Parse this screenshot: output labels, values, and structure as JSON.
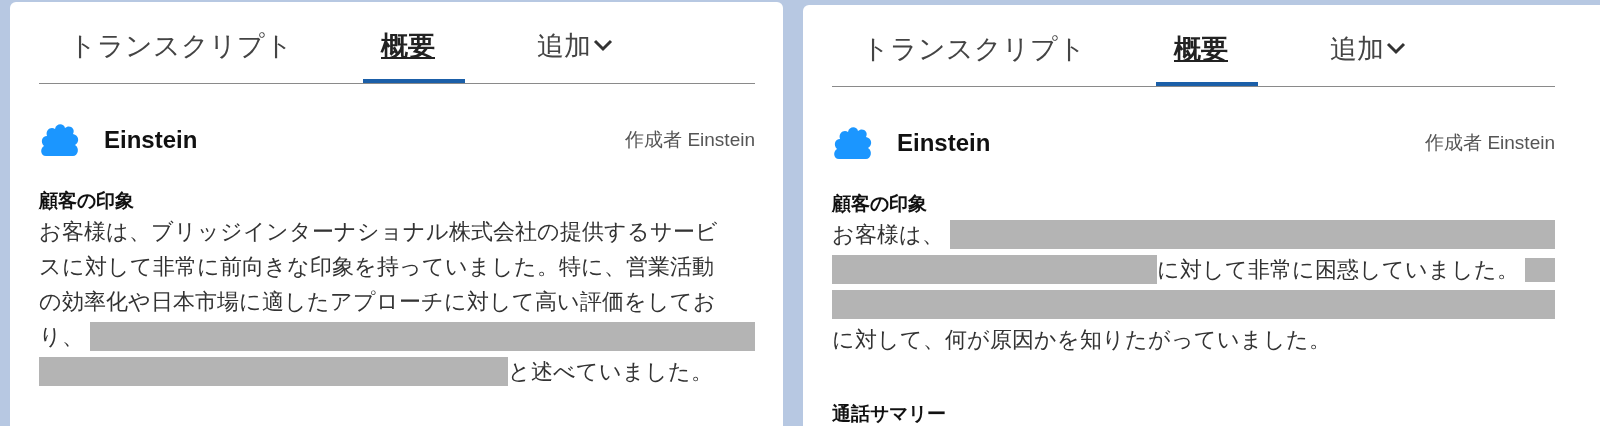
{
  "panels": [
    {
      "tabs": [
        {
          "label": "トランスクリプト",
          "selected": false,
          "kind": "tab"
        },
        {
          "label": "概要",
          "selected": true,
          "kind": "tab"
        },
        {
          "label": "追加",
          "selected": false,
          "kind": "menu"
        }
      ],
      "header": {
        "name": "Einstein",
        "author": "作成者 Einstein"
      },
      "sections": [
        {
          "heading": "顧客の印象",
          "lines": [
            [
              {
                "kind": "text",
                "text": "お客様は、ブリッジインターナショナル株式会社の提供するサービ"
              }
            ],
            [
              {
                "kind": "text",
                "text": "スに対して非常に前向きな印象を持っていました。特に、営業活動"
              }
            ],
            [
              {
                "kind": "text",
                "text": "の効率化や日本市場に適したアプローチに対して高い評価をしてお"
              }
            ],
            [
              {
                "kind": "text",
                "text": "り、"
              },
              {
                "kind": "redacted"
              }
            ],
            [
              {
                "kind": "redacted"
              },
              {
                "kind": "text",
                "text": "と述べていました。"
              },
              {
                "kind": "gap"
              }
            ]
          ]
        }
      ]
    },
    {
      "tabs": [
        {
          "label": "トランスクリプト",
          "selected": false,
          "kind": "tab"
        },
        {
          "label": "概要",
          "selected": true,
          "kind": "tab"
        },
        {
          "label": "追加",
          "selected": false,
          "kind": "menu"
        }
      ],
      "header": {
        "name": "Einstein",
        "author": "作成者 Einstein"
      },
      "sections": [
        {
          "heading": "顧客の印象",
          "lines": [
            [
              {
                "kind": "text",
                "text": "お客様は、"
              },
              {
                "kind": "redacted"
              }
            ],
            [
              {
                "kind": "redacted"
              },
              {
                "kind": "text",
                "text": "に対して非常に困惑していました。"
              },
              {
                "kind": "redacted-short"
              }
            ],
            [
              {
                "kind": "redacted"
              }
            ],
            [
              {
                "kind": "text",
                "text": "に対して、何が原因かを知りたがっていました。"
              }
            ]
          ]
        },
        {
          "heading": "通話サマリー"
        }
      ]
    }
  ]
}
